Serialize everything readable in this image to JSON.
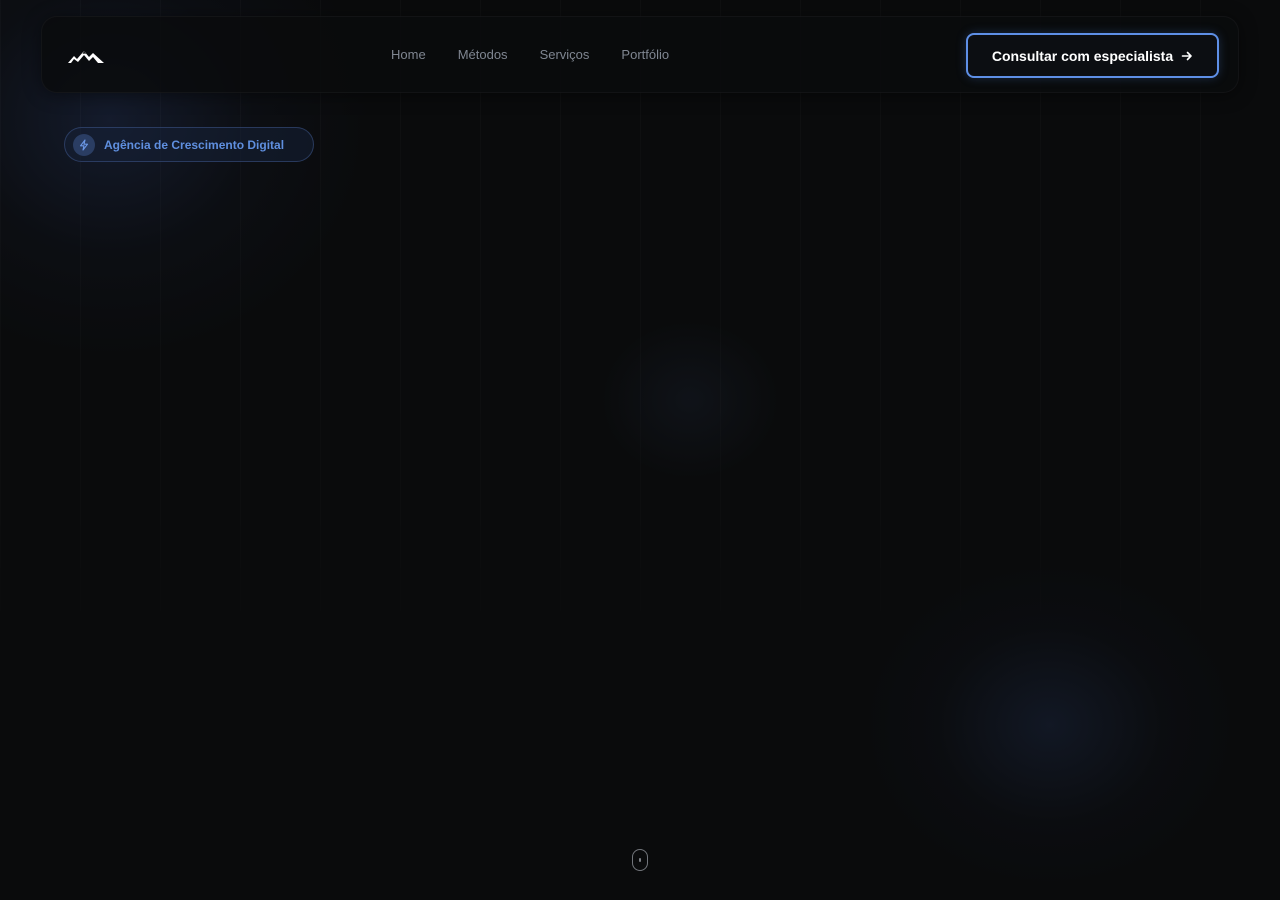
{
  "header": {
    "logo_icon": "mountain-logo-icon",
    "nav": [
      {
        "label": "Home"
      },
      {
        "label": "Métodos"
      },
      {
        "label": "Serviços"
      },
      {
        "label": "Portfólio"
      }
    ],
    "cta": {
      "label": "Consultar com especialista",
      "icon": "arrow-right-icon",
      "border_color": "#5e8fe6"
    }
  },
  "hero": {
    "badge": {
      "icon": "lightning-bolt-icon",
      "label": "Agência de Crescimento Digital",
      "color": "#5f8fdf"
    }
  },
  "scroll": {
    "icon": "mouse-scroll-icon"
  },
  "colors": {
    "background": "#0a0b0c",
    "nav_text": "#7f8691",
    "accent": "#5e8fe6"
  }
}
